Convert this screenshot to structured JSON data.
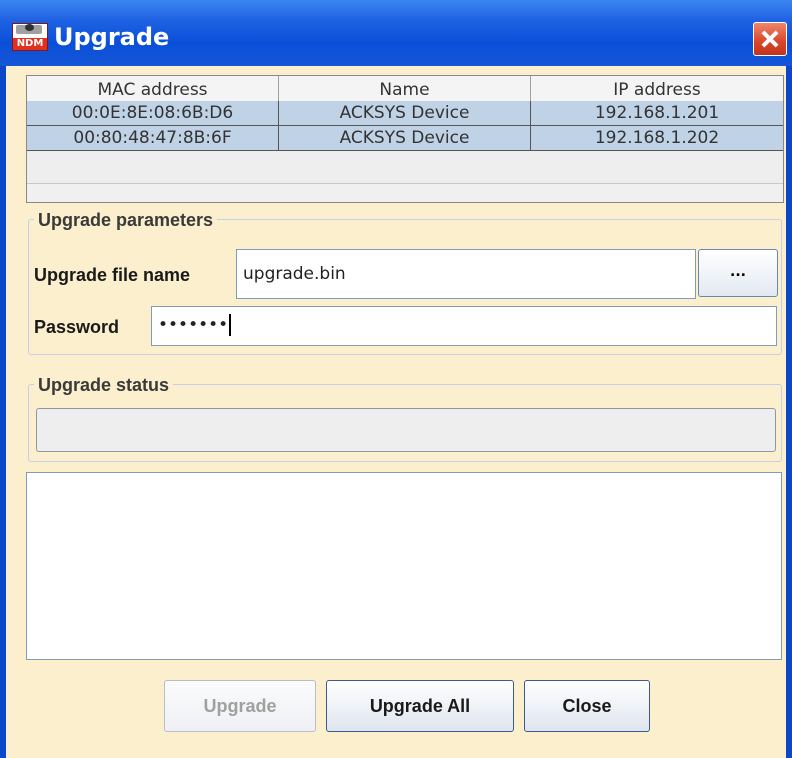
{
  "window": {
    "title": "Upgrade",
    "icon_label": "NDM",
    "colors": {
      "titlebar": "#1f62e3",
      "content_bg": "#fbefcd",
      "row_selected": "#bfd2e6",
      "close": "#d8462a"
    }
  },
  "table": {
    "columns": [
      "MAC address",
      "Name",
      "IP address"
    ],
    "rows": [
      [
        "00:0E:8E:08:6B:D6",
        "ACKSYS Device",
        "192.168.1.201"
      ],
      [
        "00:80:48:47:8B:6F",
        "ACKSYS Device",
        "192.168.1.202"
      ]
    ]
  },
  "params": {
    "group_title": "Upgrade parameters",
    "file_label": "Upgrade file name",
    "file_value": "upgrade.bin",
    "browse_label": "...",
    "password_label": "Password",
    "password_masked": "•••••••"
  },
  "status": {
    "group_title": "Upgrade status"
  },
  "buttons": {
    "upgrade": "Upgrade",
    "upgrade_all": "Upgrade All",
    "close": "Close"
  }
}
